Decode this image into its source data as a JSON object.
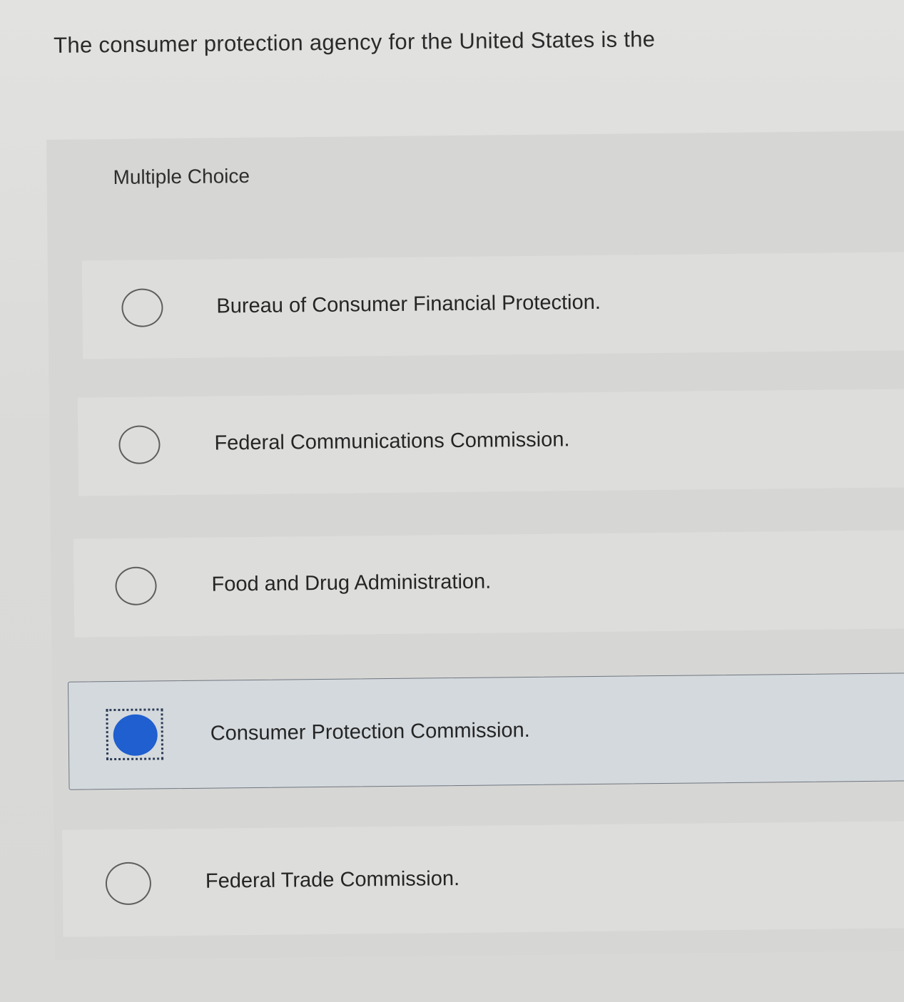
{
  "question": {
    "text": "The consumer protection agency for the United States is the"
  },
  "multiple_choice": {
    "header": "Multiple Choice",
    "options": [
      {
        "label": "Bureau of Consumer Financial Protection.",
        "selected": false
      },
      {
        "label": "Federal Communications Commission.",
        "selected": false
      },
      {
        "label": "Food and Drug Administration.",
        "selected": false
      },
      {
        "label": "Consumer Protection Commission.",
        "selected": true
      },
      {
        "label": "Federal Trade Commission.",
        "selected": false
      }
    ]
  },
  "colors": {
    "selected_radio": "#1f5fcf",
    "selected_row_background": "#d4d9dd"
  }
}
